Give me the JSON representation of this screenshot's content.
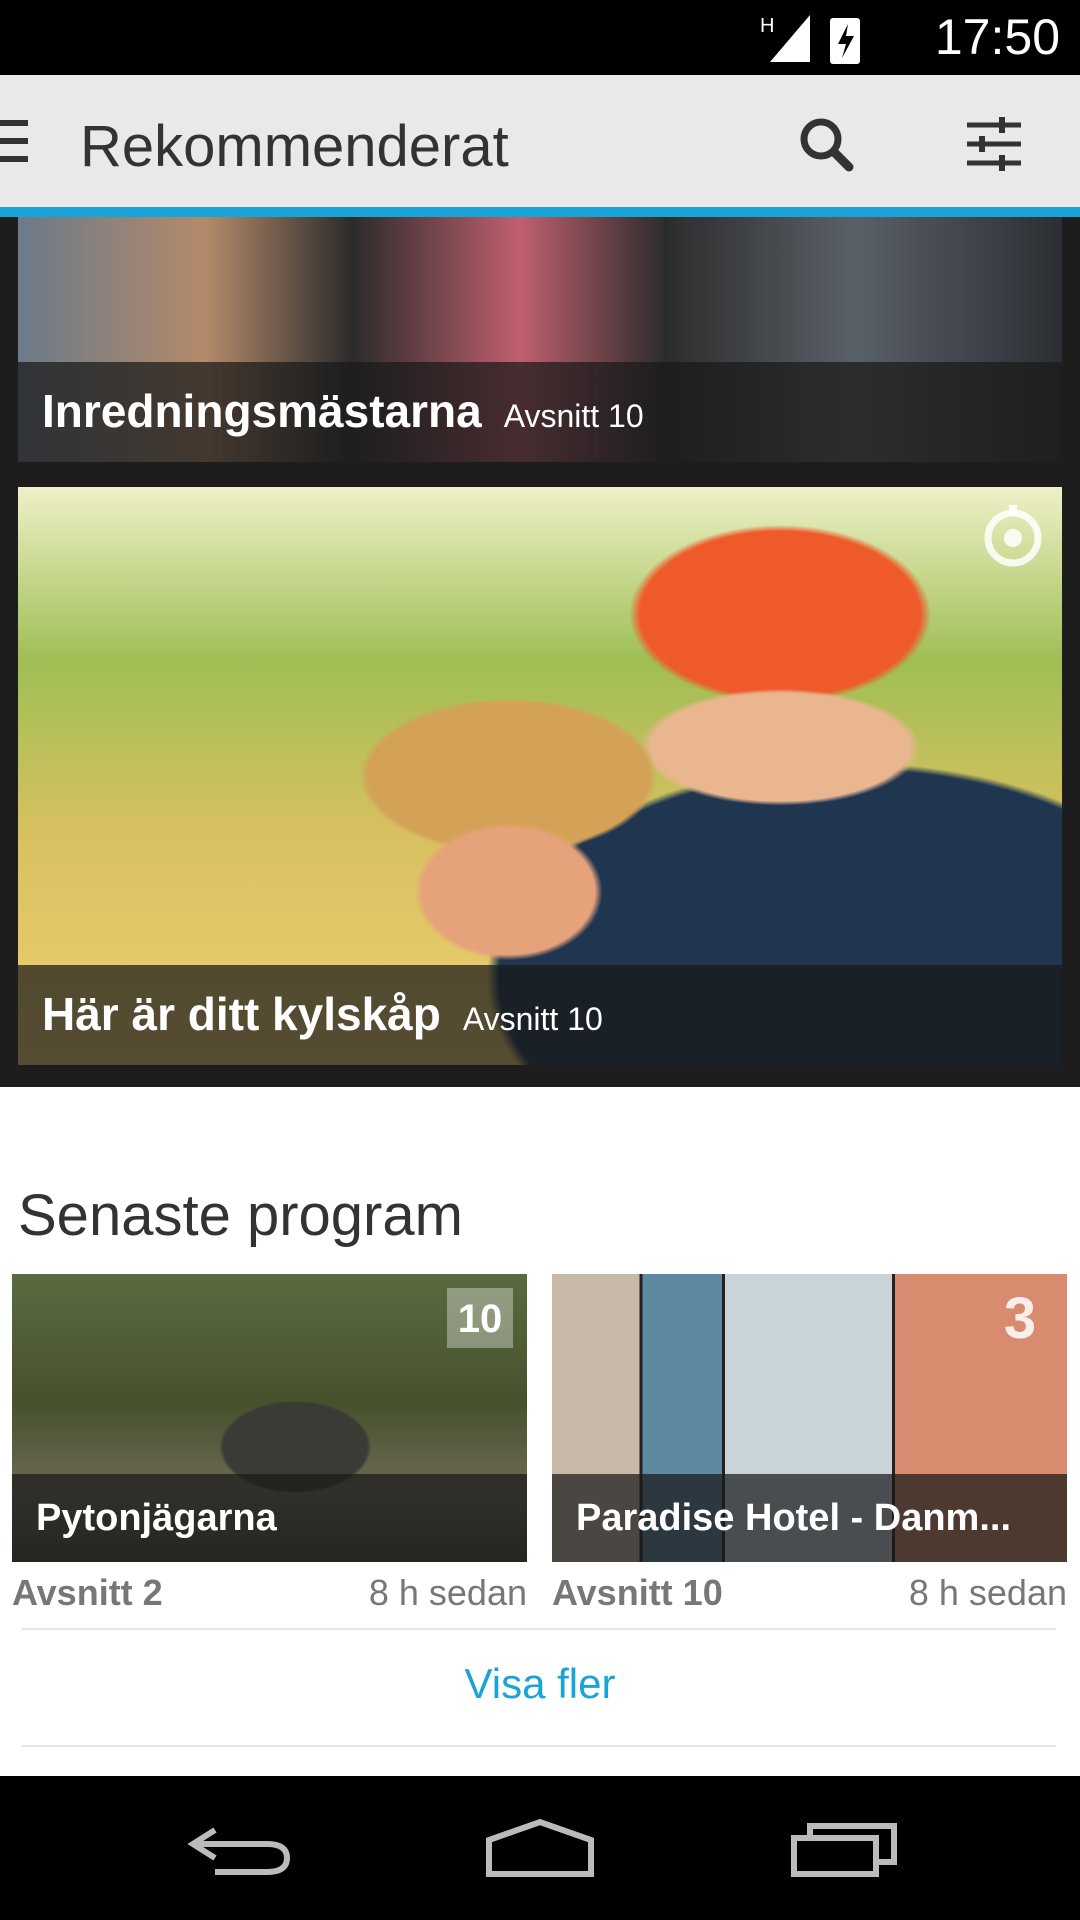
{
  "status": {
    "time": "17:50",
    "network": "H",
    "icons": [
      "signal-icon",
      "battery-charging-icon"
    ]
  },
  "appbar": {
    "title": "Rekommenderat",
    "icons": [
      "menu-icon",
      "search-icon",
      "tune-icon"
    ]
  },
  "featured": [
    {
      "title": "Inredningsmästarna",
      "episode": "Avsnitt 10"
    },
    {
      "title": "Här är ditt kylskåp",
      "episode": "Avsnitt 10",
      "channel_icon": "channel-ring-icon"
    }
  ],
  "latest": {
    "section_title": "Senaste program",
    "items": [
      {
        "title": "Pytonjägarna",
        "episode": "Avsnitt 2",
        "age": "8 h sedan",
        "channel": "10"
      },
      {
        "title": "Paradise Hotel - Danm...",
        "episode": "Avsnitt 10",
        "age": "8 h sedan",
        "channel": "3"
      }
    ],
    "more_label": "Visa fler"
  },
  "navbar": {
    "icons": [
      "back-icon",
      "home-icon",
      "recents-icon"
    ]
  },
  "colors": {
    "accent": "#1aa3d6",
    "appbar_bg": "#e9e9e9",
    "strip_bg": "#1d1d1d"
  }
}
